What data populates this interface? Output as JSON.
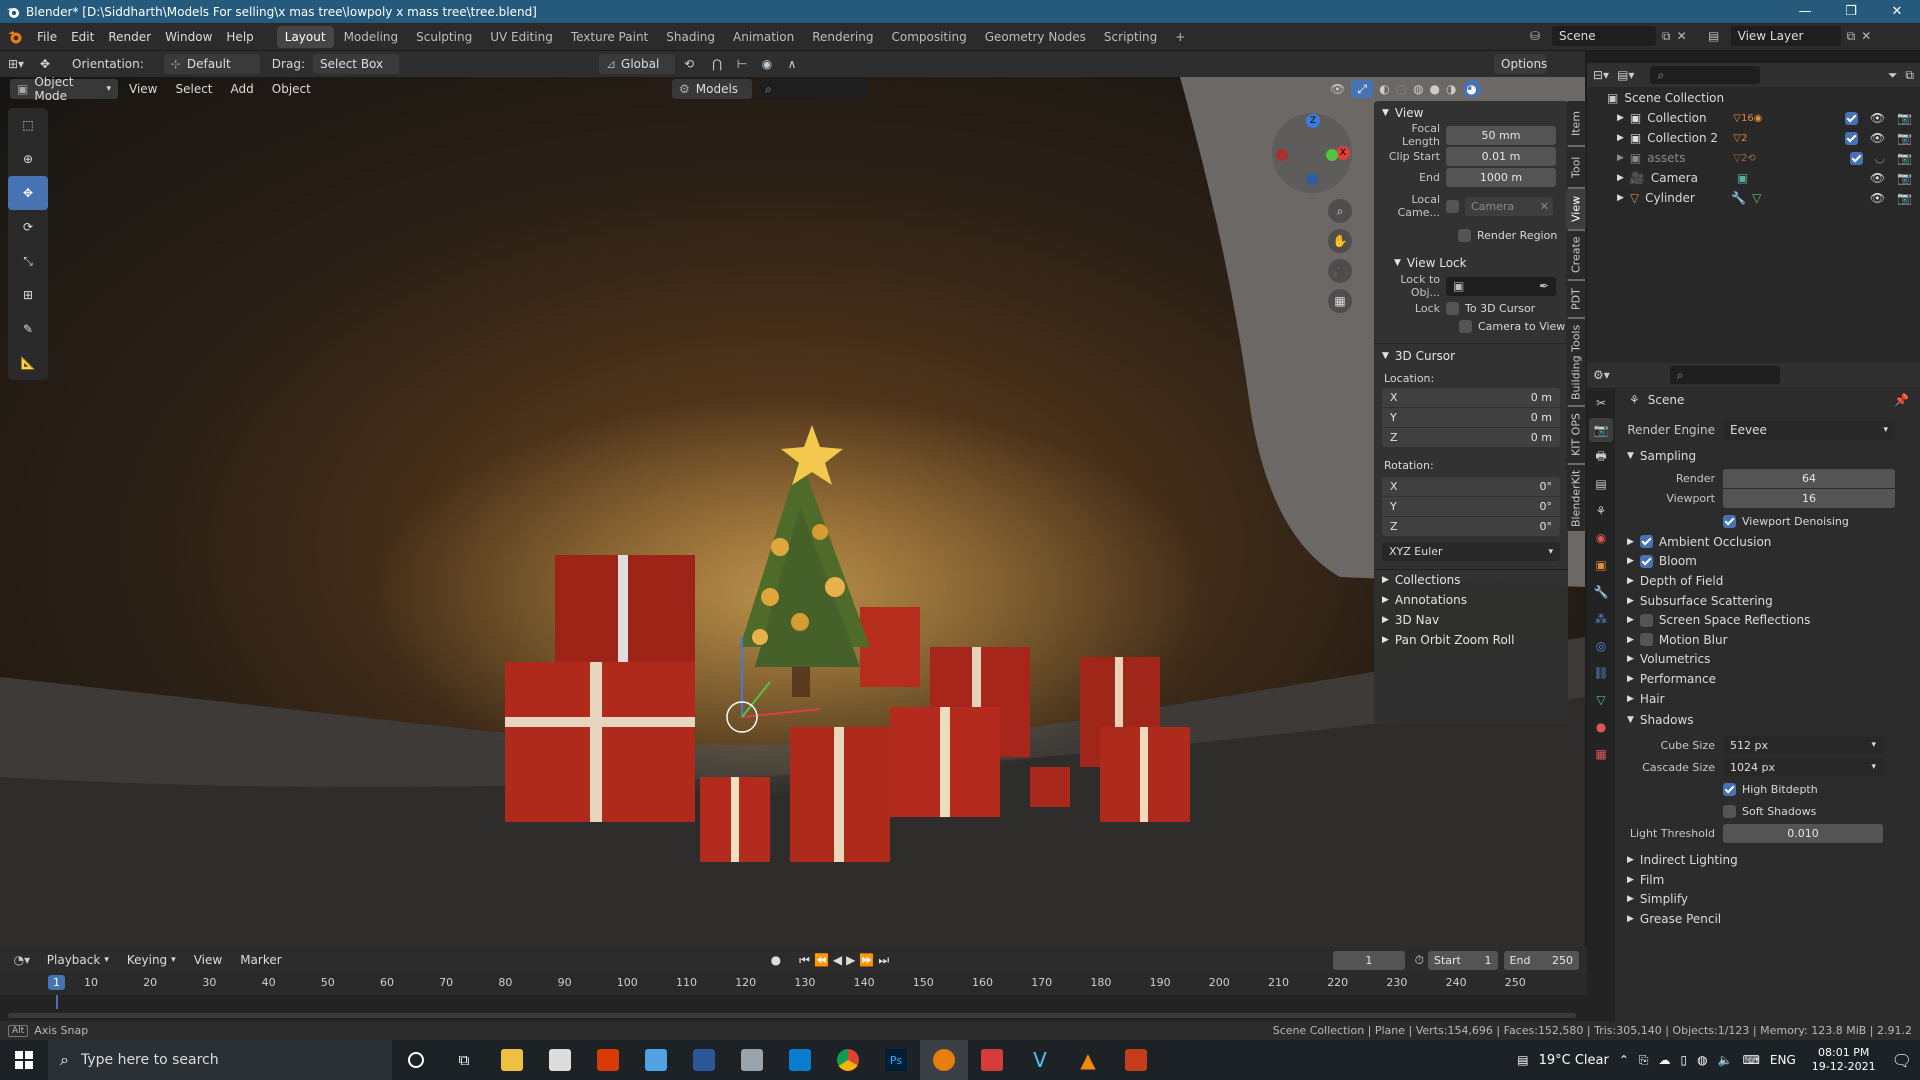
{
  "titlebar": {
    "title": "Blender* [D:\\Siddharth\\Models For selling\\x mas tree\\lowpoly x mass tree\\tree.blend]"
  },
  "menubar": {
    "menus": [
      "File",
      "Edit",
      "Render",
      "Window",
      "Help"
    ],
    "workspaces": [
      "Layout",
      "Modeling",
      "Sculpting",
      "UV Editing",
      "Texture Paint",
      "Shading",
      "Animation",
      "Rendering",
      "Compositing",
      "Geometry Nodes",
      "Scripting"
    ],
    "scene": "Scene",
    "view_layer": "View Layer"
  },
  "toolheader": {
    "orientation_label": "Orientation:",
    "orientation_value": "Default",
    "drag_label": "Drag:",
    "drag_value": "Select Box",
    "transform": "Global",
    "options": "Options"
  },
  "viewport_header": {
    "mode": "Object Mode",
    "menus": [
      "View",
      "Select",
      "Add",
      "Object"
    ],
    "collection_filter": "Models"
  },
  "npanel": {
    "tabs": [
      "Item",
      "Tool",
      "View",
      "Create",
      "PDT",
      "Building Tools",
      "KIT OPS",
      "BlenderKit"
    ],
    "view": {
      "header": "View",
      "focal_length_label": "Focal Length",
      "focal_length": "50 mm",
      "clip_start_label": "Clip Start",
      "clip_start": "0.01 m",
      "clip_end_label": "End",
      "clip_end": "1000 m",
      "local_camera_label": "Local Came...",
      "local_camera": "Camera",
      "render_region": "Render Region"
    },
    "view_lock": {
      "header": "View Lock",
      "lock_to_obj_label": "Lock to Obj...",
      "lock_label": "Lock",
      "to_3d_cursor": "To 3D Cursor",
      "camera_to_view": "Camera to View"
    },
    "cursor": {
      "header": "3D Cursor",
      "location_label": "Location:",
      "loc_x": "0 m",
      "loc_y": "0 m",
      "loc_z": "0 m",
      "rotation_label": "Rotation:",
      "rot_x": "0°",
      "rot_y": "0°",
      "rot_z": "0°",
      "rotation_mode": "XYZ Euler",
      "x": "X",
      "y": "Y",
      "z": "Z"
    },
    "collapsed": [
      "Collections",
      "Annotations",
      "3D Nav",
      "Pan Orbit Zoom Roll"
    ]
  },
  "outliner": {
    "root": "Scene Collection",
    "items": [
      {
        "name": "Collection",
        "badge": "16"
      },
      {
        "name": "Collection 2",
        "badge": "2"
      },
      {
        "name": "assets",
        "badge": "2"
      },
      {
        "name": "Camera",
        "badge": ""
      },
      {
        "name": "Cylinder",
        "badge": ""
      }
    ]
  },
  "properties": {
    "context": "Scene",
    "render_engine_label": "Render Engine",
    "render_engine": "Eevee",
    "sampling": "Sampling",
    "render_label": "Render",
    "render_samples": "64",
    "viewport_label": "Viewport",
    "viewport_samples": "16",
    "viewport_denoising": "Viewport Denoising",
    "panels": [
      {
        "label": "Ambient Occlusion",
        "check": true
      },
      {
        "label": "Bloom",
        "check": true
      },
      {
        "label": "Depth of Field",
        "check": null
      },
      {
        "label": "Subsurface Scattering",
        "check": null
      },
      {
        "label": "Screen Space Reflections",
        "check": false
      },
      {
        "label": "Motion Blur",
        "check": false
      },
      {
        "label": "Volumetrics",
        "check": null
      },
      {
        "label": "Performance",
        "check": null
      },
      {
        "label": "Hair",
        "check": null
      }
    ],
    "shadows": "Shadows",
    "cube_size_label": "Cube Size",
    "cube_size": "512 px",
    "cascade_size_label": "Cascade Size",
    "cascade_size": "1024 px",
    "high_bitdepth": "High Bitdepth",
    "soft_shadows": "Soft Shadows",
    "light_threshold_label": "Light Threshold",
    "light_threshold": "0.010",
    "panels2": [
      "Indirect Lighting",
      "Film",
      "Simplify",
      "Grease Pencil"
    ]
  },
  "timeline": {
    "menus": [
      "Playback",
      "Keying",
      "View",
      "Marker"
    ],
    "current_frame": "1",
    "start_label": "Start",
    "start": "1",
    "end_label": "End",
    "end": "250",
    "ruler": [
      "1",
      "10",
      "20",
      "30",
      "40",
      "50",
      "60",
      "70",
      "80",
      "90",
      "100",
      "110",
      "120",
      "130",
      "140",
      "150",
      "160",
      "170",
      "180",
      "190",
      "200",
      "210",
      "220",
      "230",
      "240",
      "250"
    ]
  },
  "statusbar": {
    "left": "Axis Snap",
    "alt_key": "Alt",
    "right": "Scene Collection | Plane | Verts:154,696 | Faces:152,580 | Tris:305,140 | Objects:1/123 | Memory: 123.8 MiB | 2.91.2"
  },
  "taskbar": {
    "search_placeholder": "Type here to search",
    "weather": "19°C  Clear",
    "language": "ENG",
    "time": "08:01 PM",
    "date": "19-12-2021"
  },
  "colors": {
    "accent": "#4772b3",
    "titlebar": "#255a7d",
    "viewport_warm": "#6a4522",
    "gift_red": "#a8261c",
    "tree_green": "#4e6b2a",
    "star_gold": "#f2c94c"
  }
}
